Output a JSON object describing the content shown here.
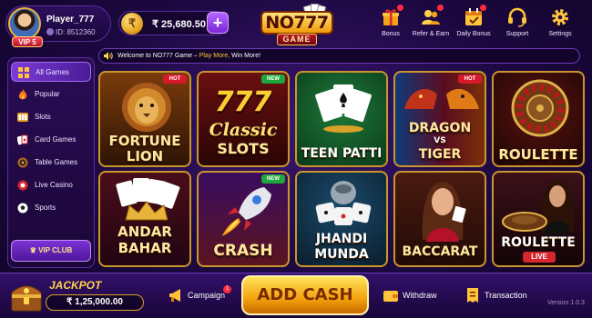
{
  "profile": {
    "name": "Player_777",
    "id": "ID: 8512360",
    "vip": "VIP 5"
  },
  "wallet": {
    "currency_symbol": "₹",
    "balance": "₹ 25,680.50",
    "add_label": "+"
  },
  "logo": {
    "main": "NO777",
    "sub": "GAME"
  },
  "nav": [
    {
      "label": "Bonus",
      "icon": "gift-icon"
    },
    {
      "label": "Refer & Earn",
      "icon": "users-icon"
    },
    {
      "label": "Daily Bonus",
      "icon": "calendar-icon"
    },
    {
      "label": "Support",
      "icon": "headset-icon"
    },
    {
      "label": "Settings",
      "icon": "gear-icon"
    }
  ],
  "ticker": {
    "prefix": "Welcome to NO777 Game – ",
    "highlight": "Play More,",
    "suffix": " Win More!"
  },
  "categories": [
    {
      "label": "All Games",
      "icon": "grid-icon",
      "active": true
    },
    {
      "label": "Popular",
      "icon": "flame-icon"
    },
    {
      "label": "Slots",
      "icon": "slot-machine-icon"
    },
    {
      "label": "Card Games",
      "icon": "cards-icon"
    },
    {
      "label": "Table Games",
      "icon": "table-icon"
    },
    {
      "label": "Live Casino",
      "icon": "live-icon"
    },
    {
      "label": "Sports",
      "icon": "football-icon"
    }
  ],
  "vip_club": "VIP CLUB",
  "games": [
    {
      "title_line1": "FORTUNE",
      "title_line2": "LION",
      "badge": "HOT"
    },
    {
      "title_line1": "Classic",
      "title_line2": "SLOTS",
      "badge": "NEW",
      "logo": "777"
    },
    {
      "title_line1": "TEEN PATTI",
      "title_line2": "",
      "badge": ""
    },
    {
      "title_line1": "DRAGON",
      "title_line2": "TIGER",
      "title_mid": "VS",
      "badge": "HOT"
    },
    {
      "title_line1": "ROULETTE",
      "title_line2": "",
      "badge": ""
    },
    {
      "title_line1": "ANDAR",
      "title_line2": "BAHAR",
      "badge": ""
    },
    {
      "title_line1": "CRASH",
      "title_line2": "",
      "badge": "NEW"
    },
    {
      "title_line1": "JHANDI",
      "title_line2": "MUNDA",
      "badge": ""
    },
    {
      "title_line1": "BACCARAT",
      "title_line2": "",
      "badge": ""
    },
    {
      "title_line1": "ROULETTE",
      "title_line2": "",
      "badge": "",
      "live": "LIVE"
    }
  ],
  "bottom": {
    "jackpot_label": "JACKPOT",
    "jackpot_value": "₹ 1,25,000.00",
    "campaign": "Campaign",
    "campaign_badge": "1",
    "add_cash": "ADD CASH",
    "withdraw": "Withdraw",
    "transaction": "Transaction",
    "version": "Version 1.0.3"
  },
  "colors": {
    "accent_gold": "#e8b33a",
    "hot": "#d8192b",
    "new": "#1ea83b",
    "purple": "#7b3cd6"
  }
}
